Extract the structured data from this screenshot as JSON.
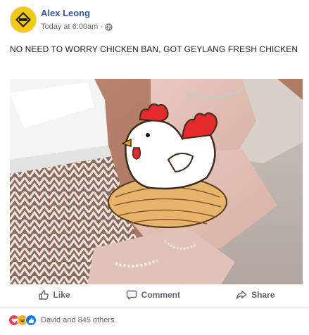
{
  "post": {
    "author": "Alex Leong",
    "timestamp": "Today at 6:00am",
    "separator": "·",
    "privacy_icon": "globe-icon",
    "text": "NO NEED TO WORRY CHICKEN BAN, GOT GEYLANG FRESH CHICKEN"
  },
  "actions": {
    "like": "Like",
    "comment": "Comment",
    "share": "Share"
  },
  "reactions": {
    "icons": [
      "love-reaction-icon",
      "haha-reaction-icon",
      "like-reaction-icon"
    ],
    "summary": "David and 845 others"
  },
  "colors": {
    "link_blue": "#385898",
    "meta_gray": "#606770",
    "like_blue": "#1877f2",
    "love_red": "#f33e58",
    "haha_yellow": "#f7b125"
  }
}
